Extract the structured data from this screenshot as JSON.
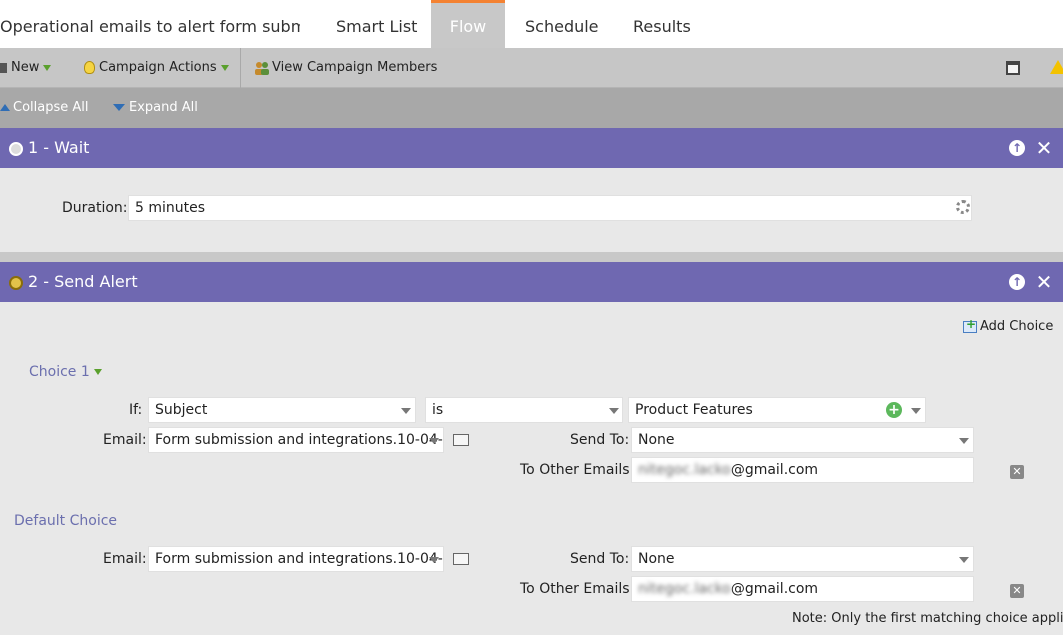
{
  "tabs": {
    "title": "Operational emails to alert form subm...",
    "smart_list": "Smart List",
    "flow": "Flow",
    "schedule": "Schedule",
    "results": "Results"
  },
  "toolbar": {
    "new_label": "New",
    "campaign_actions_label": "Campaign Actions",
    "view_members_label": "View Campaign Members"
  },
  "collapse_bar": {
    "collapse_label": "Collapse All",
    "expand_label": "Expand All"
  },
  "steps": [
    {
      "title": "1 - Wait",
      "duration_label": "Duration:",
      "duration_value": "5 minutes"
    },
    {
      "title": "2 - Send Alert",
      "add_choice_label": "Add Choice",
      "choice1": {
        "heading": "Choice 1",
        "if_label": "If:",
        "attribute": "Subject",
        "operator": "is",
        "value": "Product Features",
        "email_label": "Email:",
        "email_value": "Form submission and integrations.10-04-",
        "send_to_label": "Send To:",
        "send_to_value": "None",
        "other_emails_label": "To Other Emails:",
        "other_emails_obscured": "nitegoc.lacko",
        "other_emails_domain": "@gmail.com"
      },
      "default_choice": {
        "heading": "Default Choice",
        "email_label": "Email:",
        "email_value": "Form submission and integrations.10-04-",
        "send_to_label": "Send To:",
        "send_to_value": "None",
        "other_emails_label": "To Other Emails:",
        "other_emails_obscured": "nitegoc.lacko",
        "other_emails_domain": "@gmail.com"
      },
      "note": "Note: Only the first matching choice applies"
    }
  ],
  "colors": {
    "step_header": "#6f68b1",
    "active_tab_accent": "#f48232",
    "choice_heading": "#6b6fae"
  }
}
